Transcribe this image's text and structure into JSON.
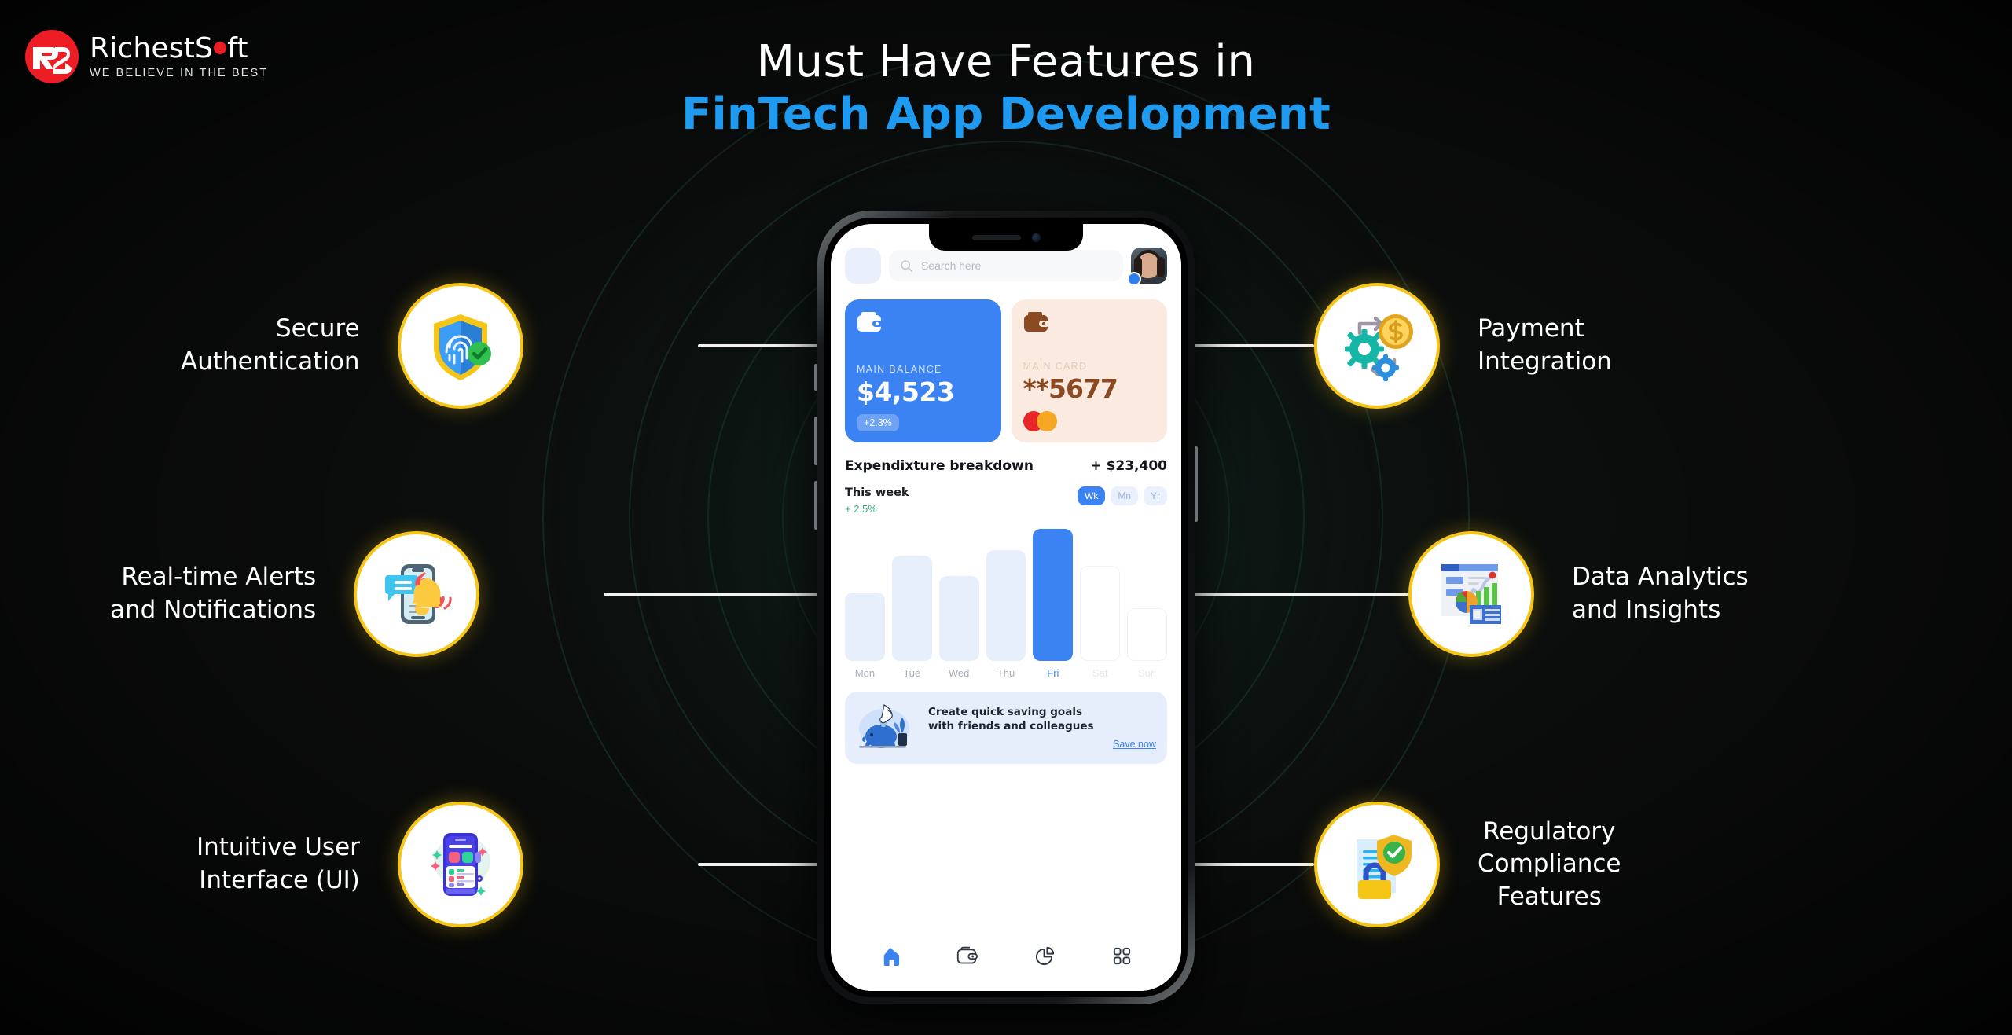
{
  "brand": {
    "name_part1": "RichestS",
    "name_part2": "ft",
    "tagline": "WE BELIEVE IN THE BEST",
    "mark_text": "RS",
    "mark_color": "#ee1c24"
  },
  "heading": {
    "line1": "Must Have Features in",
    "line2": "FinTech App Development",
    "line2_color": "#1e9bf0"
  },
  "features": [
    {
      "id": "secure-authentication",
      "label_lines": [
        "Secure",
        "Authentication"
      ],
      "icon": "fingerprint-shield-icon",
      "side": "left"
    },
    {
      "id": "real-time-alerts",
      "label_lines": [
        "Real-time Alerts",
        "and Notifications"
      ],
      "icon": "phone-bell-icon",
      "side": "left"
    },
    {
      "id": "intuitive-user-interface",
      "label_lines": [
        "Intuitive User",
        "Interface (UI)"
      ],
      "icon": "mobile-ui-icon",
      "side": "left"
    },
    {
      "id": "payment-integration",
      "label_lines": [
        "Payment",
        "Integration"
      ],
      "icon": "gears-coin-icon",
      "side": "right"
    },
    {
      "id": "data-analytics",
      "label_lines": [
        "Data Analytics",
        "and Insights"
      ],
      "icon": "analytics-dashboard-icon",
      "side": "right"
    },
    {
      "id": "regulatory-compliance",
      "label_lines": [
        "Regulatory",
        "Compliance",
        "Features"
      ],
      "icon": "document-lock-shield-icon",
      "side": "right"
    }
  ],
  "phone_app": {
    "search_placeholder": "Search here",
    "balance_card": {
      "title": "MAIN BALANCE",
      "amount": "$4,523",
      "change": "+2.3%",
      "color": "#3b82f2"
    },
    "main_card": {
      "title": "MAIN CARD",
      "number": "**5677",
      "brand": "mastercard-logo",
      "color": "#fbeadf"
    },
    "breakdown": {
      "title": "Expendixture breakdown",
      "total": "+ $23,400",
      "period_label": "This week",
      "period_change": "+ 2.5%",
      "range_options": [
        "Wk",
        "Mn",
        "Yr"
      ],
      "range_selected": "Wk"
    },
    "promo": {
      "line1": "Create quick saving goals",
      "line2": "with friends and colleagues",
      "link": "Save now"
    },
    "tabs": [
      {
        "name": "home-tab",
        "icon": "home-icon",
        "active": true
      },
      {
        "name": "wallet-tab",
        "icon": "wallet-icon",
        "active": false
      },
      {
        "name": "statistics-tab",
        "icon": "pie-chart-icon",
        "active": false
      },
      {
        "name": "apps-tab",
        "icon": "grid-icon",
        "active": false
      }
    ]
  },
  "chart_data": {
    "type": "bar",
    "title": "Expendixture breakdown",
    "subtitle": "This week",
    "categories": [
      "Mon",
      "Tue",
      "Wed",
      "Thu",
      "Fri",
      "Sat",
      "Sun"
    ],
    "values": [
      52,
      80,
      64,
      84,
      100,
      72,
      40
    ],
    "highlight": "Fri",
    "inactive": [
      "Sat",
      "Sun"
    ],
    "xlabel": "",
    "ylabel": "",
    "ylim": [
      0,
      100
    ],
    "grid": false,
    "legend": "none",
    "bar_color": "#e7effb",
    "highlight_color": "#3b82f2"
  }
}
